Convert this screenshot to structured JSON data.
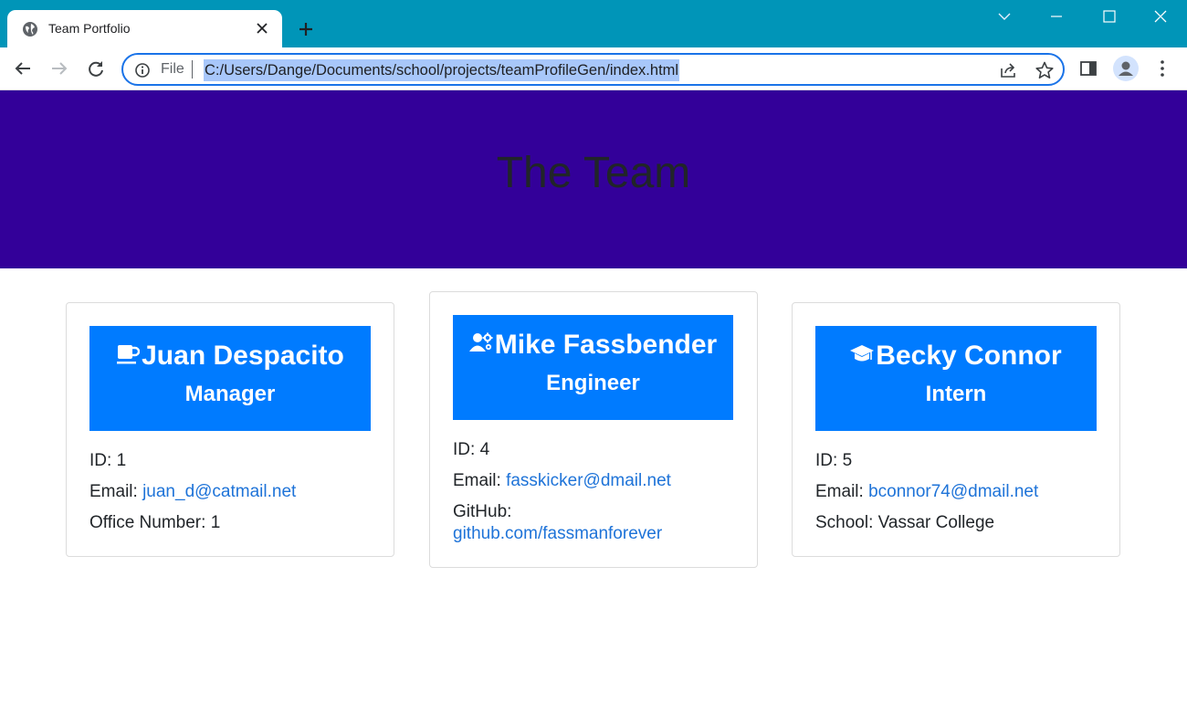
{
  "browser": {
    "tab_title": "Team Portfolio",
    "url_scheme": "File",
    "url": "C:/Users/Dange/Documents/school/projects/teamProfileGen/index.html"
  },
  "page": {
    "title": "The Team",
    "colors": {
      "jumbotron": "#330099",
      "card_header": "#007bff",
      "link": "#1e73d8"
    },
    "cards": [
      {
        "name": "Juan Despacito",
        "role": "Manager",
        "icon": "coffee-mug-icon",
        "id_label": "ID:",
        "id": "1",
        "email_label": "Email:",
        "email": "juan_d@catmail.net",
        "extra_label": "Office Number:",
        "extra": "1"
      },
      {
        "name": "Mike Fassbender",
        "role": "Engineer",
        "icon": "user-gear-icon",
        "id_label": "ID:",
        "id": "4",
        "email_label": "Email:",
        "email": "fasskicker@dmail.net",
        "extra_label": "GitHub:",
        "extra": "github.com/fassmanforever"
      },
      {
        "name": "Becky Connor",
        "role": "Intern",
        "icon": "graduation-cap-icon",
        "id_label": "ID:",
        "id": "5",
        "email_label": "Email:",
        "email": "bconnor74@dmail.net",
        "extra_label": "School:",
        "extra": "Vassar College"
      }
    ]
  }
}
